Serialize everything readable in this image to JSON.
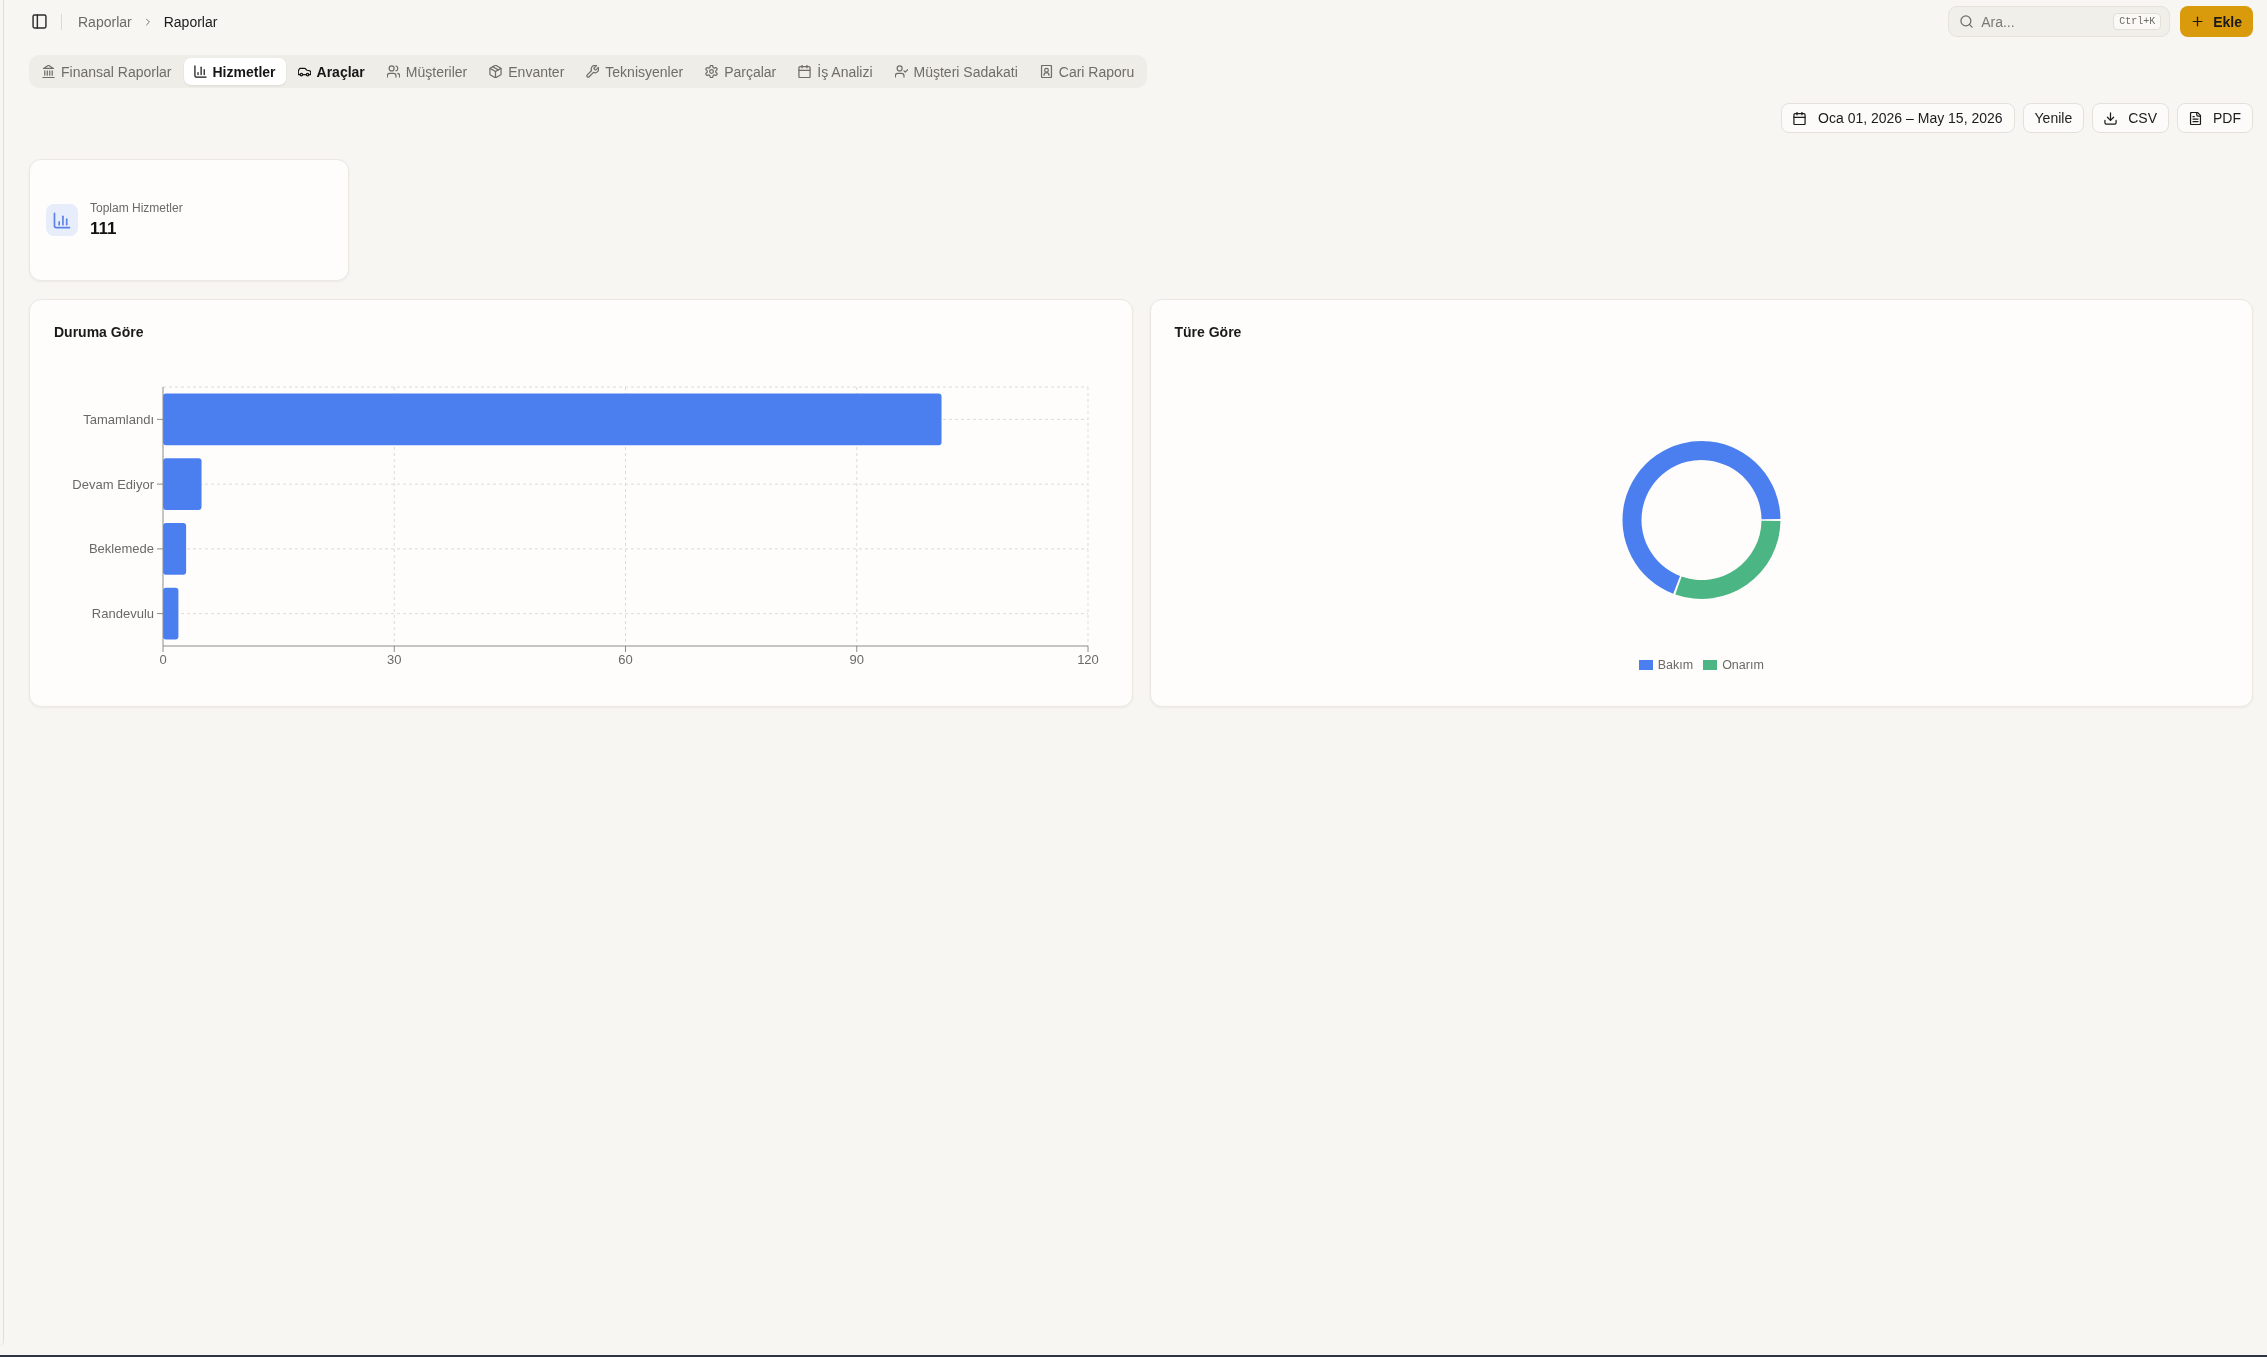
{
  "header": {
    "breadcrumb": [
      {
        "label": "Raporlar",
        "current": false
      },
      {
        "label": "Raporlar",
        "current": true
      }
    ],
    "search": {
      "placeholder": "Ara...",
      "shortcut": "Ctrl+K"
    },
    "add_button": {
      "label": "Ekle"
    }
  },
  "tabs": [
    {
      "label": "Finansal Raporlar",
      "selected": false,
      "hovered": false
    },
    {
      "label": "Hizmetler",
      "selected": true,
      "hovered": false
    },
    {
      "label": "Araçlar",
      "selected": false,
      "hovered": true
    },
    {
      "label": "Müşteriler",
      "selected": false,
      "hovered": false
    },
    {
      "label": "Envanter",
      "selected": false,
      "hovered": false
    },
    {
      "label": "Teknisyenler",
      "selected": false,
      "hovered": false
    },
    {
      "label": "Parçalar",
      "selected": false,
      "hovered": false
    },
    {
      "label": "İş Analizi",
      "selected": false,
      "hovered": false
    },
    {
      "label": "Müşteri Sadakati",
      "selected": false,
      "hovered": false
    },
    {
      "label": "Cari Raporu",
      "selected": false,
      "hovered": false
    }
  ],
  "toolbar": {
    "date_range": "Oca 01, 2026 – May 15, 2026",
    "buttons": [
      {
        "label": "Yenile"
      },
      {
        "label": "CSV"
      },
      {
        "label": "PDF"
      }
    ]
  },
  "stats": [
    {
      "label": "Toplam Hizmetler",
      "value": "111"
    }
  ],
  "charts": [
    {
      "title": "Duruma Göre",
      "chart_data": {
        "type": "bar",
        "orientation": "horizontal",
        "grid": true,
        "categories": [
          "Tamamlandı",
          "Devam Ediyor",
          "Beklemede",
          "Randevulu"
        ],
        "values": [
          101,
          5,
          3,
          2
        ],
        "xlim": [
          0,
          120
        ],
        "xticks": [
          0,
          30,
          60,
          90,
          120
        ]
      }
    },
    {
      "title": "Türe Göre",
      "chart_data": {
        "type": "donut",
        "categories": [
          "Bakım",
          "Onarım"
        ],
        "values": [
          69.4,
          30.6
        ],
        "colors": [
          "#4b7ff0",
          "#4cb584"
        ]
      }
    }
  ]
}
